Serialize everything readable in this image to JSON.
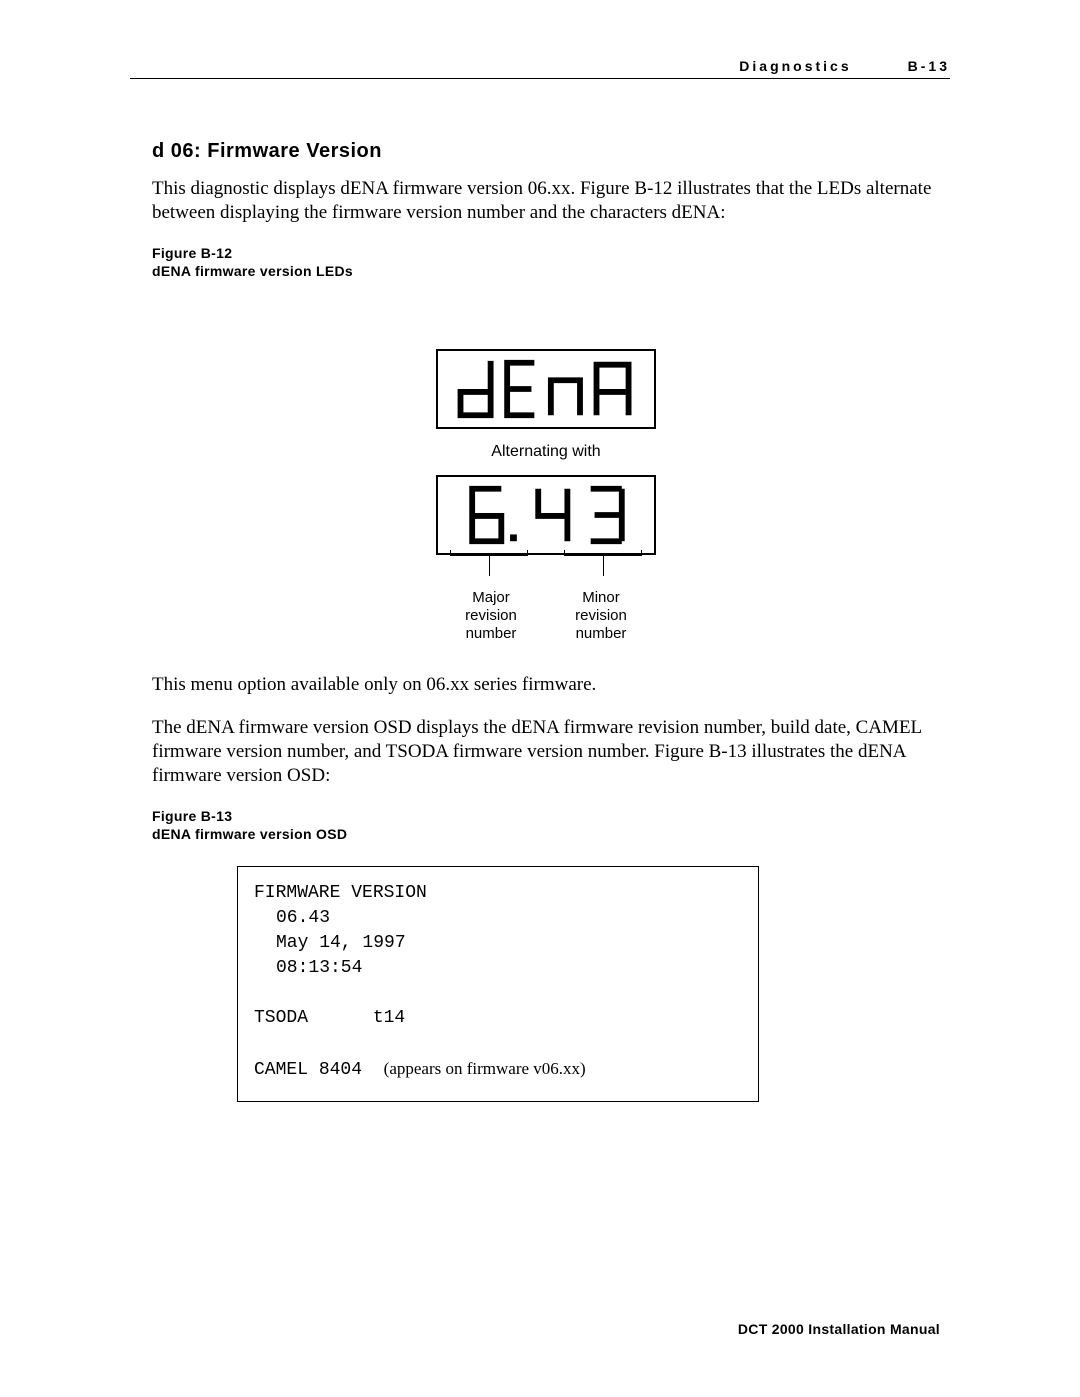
{
  "header": {
    "section": "Diagnostics",
    "pageno": "B-13"
  },
  "footer": "DCT 2000 Installation Manual",
  "heading": "d 06: Firmware Version",
  "intro": "This diagnostic displays dENA firmware version 06.xx. Figure B-12 illustrates that the LEDs alternate between displaying the firmware version number and the characters dENA:",
  "figB12": {
    "num": "Figure B-12",
    "title": "dENA firmware version LEDs"
  },
  "led1_text": "dENA",
  "alternating": "Alternating with",
  "led2_text": "6.43",
  "rev_major": "Major revision number",
  "rev_minor": "Minor revision number",
  "rev_major_l1": "Major",
  "rev_major_l2": "revision",
  "rev_major_l3": "number",
  "rev_minor_l1": "Minor",
  "rev_minor_l2": "revision",
  "rev_minor_l3": "number",
  "after_led": "This menu option available only on 06.xx series firmware.",
  "osd_para": "The dENA firmware version OSD displays the dENA firmware revision number, build date, CAMEL firmware version number, and TSODA firmware version number. Figure B-13 illustrates the dENA firmware version OSD:",
  "figB13": {
    "num": "Figure B-13",
    "title": "dENA firmware version OSD"
  },
  "osd": {
    "title": "FIRMWARE VERSION",
    "ver": "06.43",
    "date": "May 14, 1997",
    "time": "08:13:54",
    "tsoda_label": "TSODA",
    "tsoda_val": "t14",
    "camel_label": "CAMEL",
    "camel_val": "8404",
    "camel_note": "(appears on firmware v06.xx)"
  }
}
